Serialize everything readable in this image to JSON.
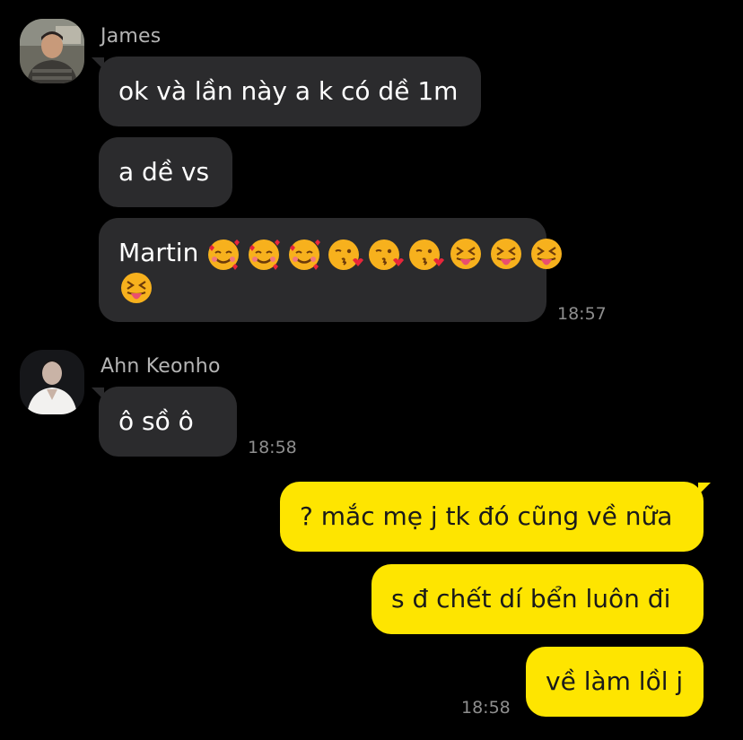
{
  "chat": {
    "messages_group1": {
      "sender": "James",
      "bubbles": [
        "ok và lần này a k có dề 1m",
        "a dề vs",
        "Martin"
      ],
      "emoji_names": [
        "smiling-face-with-hearts",
        "smiling-face-with-hearts",
        "smiling-face-with-hearts",
        "face-blowing-kiss",
        "face-blowing-kiss",
        "face-blowing-kiss",
        "squinting-face-with-tongue",
        "squinting-face-with-tongue",
        "squinting-face-with-tongue"
      ],
      "time": "18:57"
    },
    "messages_group2": {
      "sender": "Ahn Keonho",
      "bubbles": [
        "ô sồ ô"
      ],
      "time": "18:58"
    },
    "outgoing": {
      "bubbles": [
        "? mắc mẹ j tk đó cũng về nữa",
        "s đ chết dí bển luôn đi",
        "về làm lồl j"
      ],
      "time": "18:58"
    }
  },
  "colors": {
    "incoming_bubble": "#2b2b2d",
    "outgoing_bubble": "#fee500",
    "background": "#000000"
  }
}
